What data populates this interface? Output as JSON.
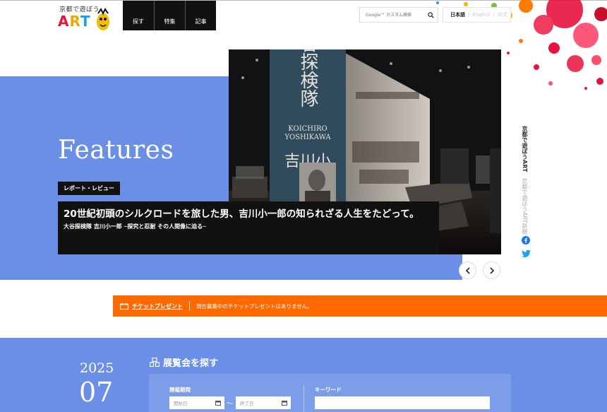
{
  "header": {
    "logo_top": "京都で遊ぼう",
    "logo_main": "ART",
    "nav": [
      {
        "label": "探す"
      },
      {
        "label": "特集"
      },
      {
        "label": "記事"
      }
    ],
    "search_placeholder": "Google™ カスタム検索",
    "languages": {
      "ja": "日本語",
      "en": "English",
      "zh": "中文",
      "separator": "/"
    }
  },
  "hero": {
    "section_title": "Features",
    "category": "レポート・レビュー",
    "title": "20世紀初頭のシルクロードを旅した男、吉川小一郎の知られざる人生をたどって。",
    "subtitle": "大谷探検隊 吉川小一郎 ─探究と忍耐 その人間像に迫る─",
    "photo_text": {
      "banner": "谷探検隊",
      "name_en_1": "KOICHIRO",
      "name_en_2": "YOSHIKAWA",
      "name_jp": "吉川小"
    }
  },
  "side": {
    "vertical_1": "京都で遊ぼうART",
    "vertical_2": "京都で遊ぼうART新館"
  },
  "ticket": {
    "label": "チケットプレゼント",
    "message": "現在募集中のチケットプレゼントはありません。"
  },
  "exhibition_search": {
    "year": "2025",
    "month": "07",
    "title": "展覧会を探す",
    "period_label": "開催期間",
    "start_placeholder": "開始日",
    "end_placeholder": "終了日",
    "range_separator": "〜",
    "keyword_label": "キーワード"
  },
  "colors": {
    "brand_blue": "#6b8ee6",
    "ticket_orange": "#ff6a00",
    "dark": "#111111"
  },
  "icons": [
    "search-icon",
    "chevron-left-icon",
    "chevron-right-icon",
    "facebook-icon",
    "twitter-icon",
    "ticket-icon",
    "building-icon",
    "calendar-icon"
  ]
}
